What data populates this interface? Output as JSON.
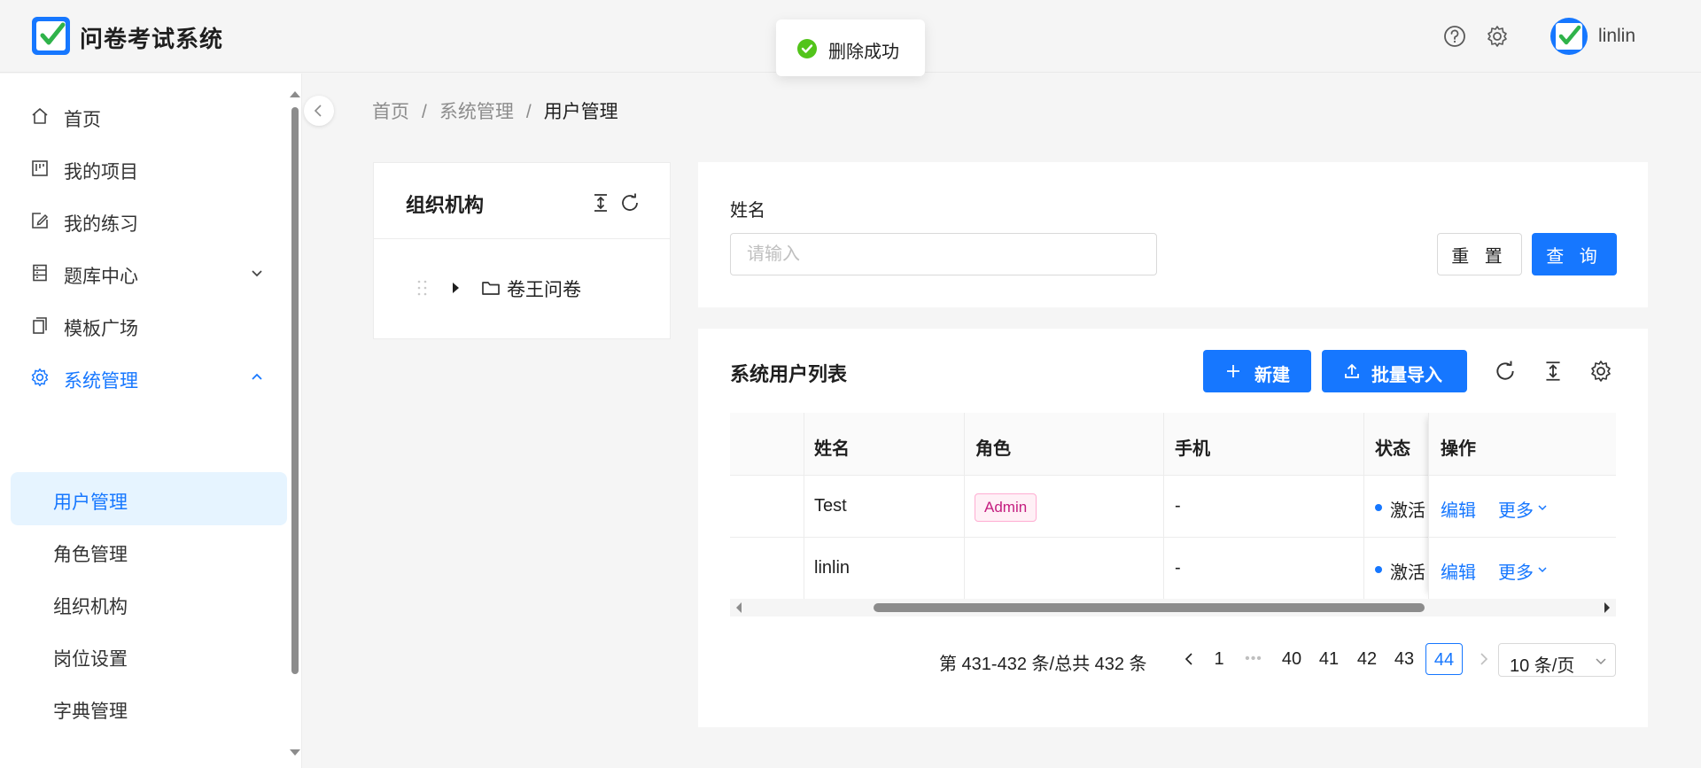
{
  "app": {
    "title": "问卷考试系统",
    "brand_color": "#1677ff"
  },
  "header": {
    "username": "linlin",
    "help_icon": "question-circle-icon",
    "settings_icon": "gear-icon"
  },
  "toast": {
    "message": "删除成功",
    "type": "success"
  },
  "sidebar": {
    "items": [
      {
        "label": "首页",
        "icon": "home-icon"
      },
      {
        "label": "我的项目",
        "icon": "project-icon"
      },
      {
        "label": "我的练习",
        "icon": "edit-icon"
      },
      {
        "label": "题库中心",
        "icon": "database-icon",
        "expanded": false
      },
      {
        "label": "模板广场",
        "icon": "copy-icon"
      },
      {
        "label": "系统管理",
        "icon": "gear-icon",
        "expanded": true
      }
    ],
    "sub_items": [
      {
        "label": "用户管理",
        "selected": true
      },
      {
        "label": "角色管理"
      },
      {
        "label": "组织机构"
      },
      {
        "label": "岗位设置"
      },
      {
        "label": "字典管理"
      }
    ]
  },
  "breadcrumb": [
    "首页",
    "系统管理",
    "用户管理"
  ],
  "org_panel": {
    "title": "组织机构",
    "tree": [
      {
        "label": "卷王问卷",
        "expanded": false
      }
    ]
  },
  "search": {
    "name_label": "姓名",
    "name_placeholder": "请输入",
    "reset_label": "重 置",
    "query_label": "查 询"
  },
  "table_panel": {
    "title": "系统用户列表",
    "new_label": "新建",
    "import_label": "批量导入",
    "columns": [
      "姓名",
      "角色",
      "手机",
      "状态",
      "操作"
    ],
    "rows": [
      {
        "name": "Test",
        "role": "Admin",
        "phone": "-",
        "status": "激活",
        "edit": "编辑",
        "more": "更多"
      },
      {
        "name": "linlin",
        "role": "",
        "phone": "-",
        "status": "激活",
        "edit": "编辑",
        "more": "更多"
      }
    ]
  },
  "pagination": {
    "total_text": "第 431-432 条/总共 432 条",
    "pages": [
      "1",
      "40",
      "41",
      "42",
      "43",
      "44"
    ],
    "current": "44",
    "page_size": "10 条/页"
  }
}
